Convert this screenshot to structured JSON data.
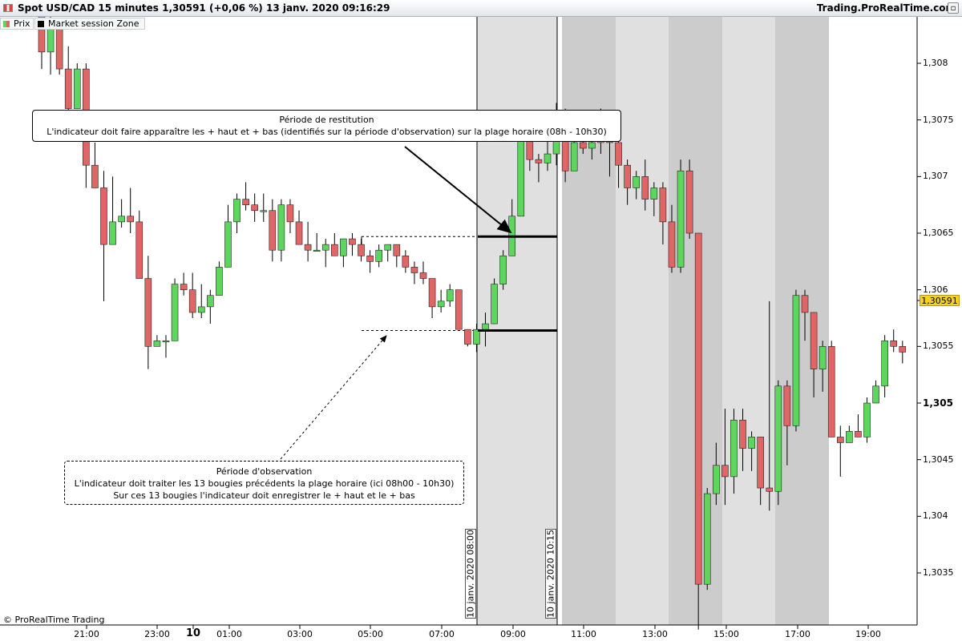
{
  "window": {
    "title": "Spot USD/CAD 15 minutes 1,30591 (+0,06 %) 13 janv. 2020 09:16:29",
    "brand": "Trading.ProRealTime.com",
    "close_glyph": "▫"
  },
  "legend": [
    {
      "label": "Prix",
      "color": "#e06666"
    },
    {
      "label": "Market session Zone",
      "color": "#000000"
    }
  ],
  "annotations": {
    "restitution": {
      "title": "Période de restitution",
      "text": "L'indicateur doit faire apparaître les + haut et + bas (identifiés sur la période d'observation) sur la plage horaire (08h - 10h30)"
    },
    "observation": {
      "title": "Période d'observation",
      "line1": "L'indicateur doit traiter les 13 bougies précédents la plage horaire (ici 08h00 - 10h30)",
      "line2": "Sur ces 13 bougies l'indicateur doit enregistrer le + haut et le + bas"
    }
  },
  "session_labels": {
    "start": "10 janv. 2020 08:00",
    "end": "10 janv. 2020 10:15"
  },
  "y_axis": [
    {
      "label": "1,308",
      "value": 1.308,
      "bold": false
    },
    {
      "label": "1,3075",
      "value": 1.3075,
      "bold": false
    },
    {
      "label": "1,307",
      "value": 1.307,
      "bold": false
    },
    {
      "label": "1,3065",
      "value": 1.3065,
      "bold": false
    },
    {
      "label": "1,306",
      "value": 1.306,
      "bold": false
    },
    {
      "label": "1,3055",
      "value": 1.3055,
      "bold": false
    },
    {
      "label": "1,305",
      "value": 1.305,
      "bold": true
    },
    {
      "label": "1,3045",
      "value": 1.3045,
      "bold": false
    },
    {
      "label": "1,304",
      "value": 1.304,
      "bold": false
    },
    {
      "label": "1,3035",
      "value": 1.3035,
      "bold": false
    }
  ],
  "x_axis": [
    {
      "label": "21:00",
      "bold": false
    },
    {
      "label": "23:00",
      "bold": false
    },
    {
      "label": "10",
      "bold": true
    },
    {
      "label": "01:00",
      "bold": false
    },
    {
      "label": "03:00",
      "bold": false
    },
    {
      "label": "05:00",
      "bold": false
    },
    {
      "label": "07:00",
      "bold": false
    },
    {
      "label": "09:00",
      "bold": false
    },
    {
      "label": "11:00",
      "bold": false
    },
    {
      "label": "13:00",
      "bold": false
    },
    {
      "label": "15:00",
      "bold": false
    },
    {
      "label": "17:00",
      "bold": false
    },
    {
      "label": "19:00",
      "bold": false
    }
  ],
  "current_price": "1,30591",
  "copyright": "© ProRealTime Trading",
  "colors": {
    "bull": "#5cd65c",
    "bear": "#e06666",
    "session_light": "#e0e0e0",
    "session_dark": "#cccccc",
    "price_tag": "#f5d21f"
  },
  "chart_data": {
    "type": "candlestick",
    "title": "Spot USD/CAD 15 minutes",
    "ylim": [
      1.303,
      1.3085
    ],
    "levels": {
      "observation_high": 1.30647,
      "observation_low": 1.30564
    },
    "candles": [
      {
        "o": 1.30855,
        "h": 1.30855,
        "l": 1.30795,
        "c": 1.3081
      },
      {
        "o": 1.3081,
        "h": 1.3085,
        "l": 1.3079,
        "c": 1.30835
      },
      {
        "o": 1.30835,
        "h": 1.30835,
        "l": 1.3079,
        "c": 1.30795
      },
      {
        "o": 1.30795,
        "h": 1.30815,
        "l": 1.3074,
        "c": 1.3076
      },
      {
        "o": 1.3076,
        "h": 1.308,
        "l": 1.3076,
        "c": 1.30795
      },
      {
        "o": 1.30795,
        "h": 1.308,
        "l": 1.3069,
        "c": 1.3071
      },
      {
        "o": 1.3071,
        "h": 1.3073,
        "l": 1.3069,
        "c": 1.3069
      },
      {
        "o": 1.3069,
        "h": 1.30705,
        "l": 1.3059,
        "c": 1.3064
      },
      {
        "o": 1.3064,
        "h": 1.307,
        "l": 1.3064,
        "c": 1.3066
      },
      {
        "o": 1.3066,
        "h": 1.3068,
        "l": 1.30655,
        "c": 1.30665
      },
      {
        "o": 1.30665,
        "h": 1.3069,
        "l": 1.3065,
        "c": 1.3066
      },
      {
        "o": 1.3066,
        "h": 1.3067,
        "l": 1.3061,
        "c": 1.3061
      },
      {
        "o": 1.3061,
        "h": 1.3063,
        "l": 1.3053,
        "c": 1.3055
      },
      {
        "o": 1.3055,
        "h": 1.3056,
        "l": 1.3055,
        "c": 1.30555
      },
      {
        "o": 1.30555,
        "h": 1.3056,
        "l": 1.3054,
        "c": 1.30555
      },
      {
        "o": 1.30555,
        "h": 1.3061,
        "l": 1.30555,
        "c": 1.30605
      },
      {
        "o": 1.30605,
        "h": 1.30615,
        "l": 1.30595,
        "c": 1.306
      },
      {
        "o": 1.306,
        "h": 1.30615,
        "l": 1.30575,
        "c": 1.3058
      },
      {
        "o": 1.3058,
        "h": 1.30605,
        "l": 1.30575,
        "c": 1.30585
      },
      {
        "o": 1.30585,
        "h": 1.306,
        "l": 1.3057,
        "c": 1.30595
      },
      {
        "o": 1.30595,
        "h": 1.30625,
        "l": 1.30595,
        "c": 1.3062
      },
      {
        "o": 1.3062,
        "h": 1.30675,
        "l": 1.3062,
        "c": 1.3066
      },
      {
        "o": 1.3066,
        "h": 1.30685,
        "l": 1.3065,
        "c": 1.3068
      },
      {
        "o": 1.3068,
        "h": 1.30695,
        "l": 1.3067,
        "c": 1.30675
      },
      {
        "o": 1.30675,
        "h": 1.30685,
        "l": 1.3066,
        "c": 1.3067
      },
      {
        "o": 1.3067,
        "h": 1.30685,
        "l": 1.3066,
        "c": 1.3067
      },
      {
        "o": 1.3067,
        "h": 1.3068,
        "l": 1.30625,
        "c": 1.30635
      },
      {
        "o": 1.30635,
        "h": 1.3068,
        "l": 1.30625,
        "c": 1.30675
      },
      {
        "o": 1.30675,
        "h": 1.3068,
        "l": 1.3065,
        "c": 1.3066
      },
      {
        "o": 1.3066,
        "h": 1.3067,
        "l": 1.3064,
        "c": 1.3064
      },
      {
        "o": 1.3064,
        "h": 1.3066,
        "l": 1.30625,
        "c": 1.30635
      },
      {
        "o": 1.30635,
        "h": 1.3065,
        "l": 1.30635,
        "c": 1.30635
      },
      {
        "o": 1.30635,
        "h": 1.30645,
        "l": 1.3062,
        "c": 1.3064
      },
      {
        "o": 1.3064,
        "h": 1.3065,
        "l": 1.3063,
        "c": 1.3063
      },
      {
        "o": 1.3063,
        "h": 1.30645,
        "l": 1.3062,
        "c": 1.30645
      },
      {
        "o": 1.30645,
        "h": 1.3065,
        "l": 1.3063,
        "c": 1.3064
      },
      {
        "o": 1.3064,
        "h": 1.30645,
        "l": 1.30625,
        "c": 1.3063
      },
      {
        "o": 1.3063,
        "h": 1.30635,
        "l": 1.30615,
        "c": 1.30625
      },
      {
        "o": 1.30625,
        "h": 1.3064,
        "l": 1.3062,
        "c": 1.30635
      },
      {
        "o": 1.30635,
        "h": 1.3064,
        "l": 1.30625,
        "c": 1.3064
      },
      {
        "o": 1.3064,
        "h": 1.3064,
        "l": 1.3062,
        "c": 1.3063
      },
      {
        "o": 1.3063,
        "h": 1.30635,
        "l": 1.30615,
        "c": 1.3062
      },
      {
        "o": 1.3062,
        "h": 1.30625,
        "l": 1.30605,
        "c": 1.30615
      },
      {
        "o": 1.30615,
        "h": 1.30625,
        "l": 1.30605,
        "c": 1.3061
      },
      {
        "o": 1.3061,
        "h": 1.3061,
        "l": 1.30575,
        "c": 1.30585
      },
      {
        "o": 1.30585,
        "h": 1.306,
        "l": 1.3058,
        "c": 1.3059
      },
      {
        "o": 1.3059,
        "h": 1.30605,
        "l": 1.30585,
        "c": 1.306
      },
      {
        "o": 1.306,
        "h": 1.306,
        "l": 1.30565,
        "c": 1.30565
      },
      {
        "o": 1.30565,
        "h": 1.30565,
        "l": 1.3055,
        "c": 1.30552
      },
      {
        "o": 1.30552,
        "h": 1.3057,
        "l": 1.30545,
        "c": 1.30565
      },
      {
        "o": 1.30565,
        "h": 1.3058,
        "l": 1.3055,
        "c": 1.3057
      },
      {
        "o": 1.3057,
        "h": 1.3061,
        "l": 1.3057,
        "c": 1.30605
      },
      {
        "o": 1.30605,
        "h": 1.30635,
        "l": 1.306,
        "c": 1.3063
      },
      {
        "o": 1.3063,
        "h": 1.3068,
        "l": 1.3063,
        "c": 1.30665
      },
      {
        "o": 1.30665,
        "h": 1.30745,
        "l": 1.30665,
        "c": 1.30735
      },
      {
        "o": 1.30735,
        "h": 1.3075,
        "l": 1.30705,
        "c": 1.30715
      },
      {
        "o": 1.30715,
        "h": 1.3072,
        "l": 1.30695,
        "c": 1.30712
      },
      {
        "o": 1.30712,
        "h": 1.3074,
        "l": 1.30705,
        "c": 1.3072
      },
      {
        "o": 1.3072,
        "h": 1.30765,
        "l": 1.3071,
        "c": 1.30755
      },
      {
        "o": 1.30755,
        "h": 1.3076,
        "l": 1.30695,
        "c": 1.30705
      },
      {
        "o": 1.30705,
        "h": 1.30735,
        "l": 1.30705,
        "c": 1.3073
      },
      {
        "o": 1.3073,
        "h": 1.3074,
        "l": 1.3072,
        "c": 1.30725
      },
      {
        "o": 1.30725,
        "h": 1.3074,
        "l": 1.30715,
        "c": 1.3073
      },
      {
        "o": 1.3073,
        "h": 1.3076,
        "l": 1.3072,
        "c": 1.30745
      },
      {
        "o": 1.30745,
        "h": 1.30755,
        "l": 1.307,
        "c": 1.3073
      },
      {
        "o": 1.3073,
        "h": 1.30735,
        "l": 1.3069,
        "c": 1.3071
      },
      {
        "o": 1.3071,
        "h": 1.30715,
        "l": 1.30675,
        "c": 1.3069
      },
      {
        "o": 1.3069,
        "h": 1.30705,
        "l": 1.3068,
        "c": 1.307
      },
      {
        "o": 1.307,
        "h": 1.30715,
        "l": 1.3067,
        "c": 1.3068
      },
      {
        "o": 1.3068,
        "h": 1.30695,
        "l": 1.30665,
        "c": 1.3069
      },
      {
        "o": 1.3069,
        "h": 1.30695,
        "l": 1.3064,
        "c": 1.3066
      },
      {
        "o": 1.3066,
        "h": 1.30675,
        "l": 1.30615,
        "c": 1.3062
      },
      {
        "o": 1.3062,
        "h": 1.30715,
        "l": 1.30615,
        "c": 1.30705
      },
      {
        "o": 1.30705,
        "h": 1.30715,
        "l": 1.30645,
        "c": 1.3065
      },
      {
        "o": 1.3065,
        "h": 1.3065,
        "l": 1.303,
        "c": 1.3034
      },
      {
        "o": 1.3034,
        "h": 1.30425,
        "l": 1.30335,
        "c": 1.3042
      },
      {
        "o": 1.3042,
        "h": 1.30465,
        "l": 1.3041,
        "c": 1.30445
      },
      {
        "o": 1.30445,
        "h": 1.30495,
        "l": 1.3041,
        "c": 1.30435
      },
      {
        "o": 1.30435,
        "h": 1.30495,
        "l": 1.3042,
        "c": 1.30485
      },
      {
        "o": 1.30485,
        "h": 1.30495,
        "l": 1.3044,
        "c": 1.3046
      },
      {
        "o": 1.3046,
        "h": 1.30475,
        "l": 1.3044,
        "c": 1.3047
      },
      {
        "o": 1.3047,
        "h": 1.3047,
        "l": 1.3041,
        "c": 1.30425
      },
      {
        "o": 1.30425,
        "h": 1.3059,
        "l": 1.30405,
        "c": 1.30422
      },
      {
        "o": 1.30422,
        "h": 1.3052,
        "l": 1.3041,
        "c": 1.30515
      },
      {
        "o": 1.30515,
        "h": 1.3052,
        "l": 1.30445,
        "c": 1.3048
      },
      {
        "o": 1.3048,
        "h": 1.306,
        "l": 1.30475,
        "c": 1.30595
      },
      {
        "o": 1.30595,
        "h": 1.306,
        "l": 1.30555,
        "c": 1.3058
      },
      {
        "o": 1.3058,
        "h": 1.3058,
        "l": 1.30505,
        "c": 1.3053
      },
      {
        "o": 1.3053,
        "h": 1.30555,
        "l": 1.3051,
        "c": 1.3055
      },
      {
        "o": 1.3055,
        "h": 1.30555,
        "l": 1.3047,
        "c": 1.3047
      },
      {
        "o": 1.3047,
        "h": 1.3048,
        "l": 1.30435,
        "c": 1.30465
      },
      {
        "o": 1.30465,
        "h": 1.3048,
        "l": 1.30465,
        "c": 1.30475
      },
      {
        "o": 1.30475,
        "h": 1.3049,
        "l": 1.3047,
        "c": 1.3047
      },
      {
        "o": 1.3047,
        "h": 1.30505,
        "l": 1.30465,
        "c": 1.305
      },
      {
        "o": 1.305,
        "h": 1.3052,
        "l": 1.305,
        "c": 1.30515
      },
      {
        "o": 1.30515,
        "h": 1.3056,
        "l": 1.30505,
        "c": 1.30555
      },
      {
        "o": 1.30555,
        "h": 1.30565,
        "l": 1.30545,
        "c": 1.3055
      },
      {
        "o": 1.3055,
        "h": 1.30555,
        "l": 1.30535,
        "c": 1.30545
      }
    ]
  }
}
